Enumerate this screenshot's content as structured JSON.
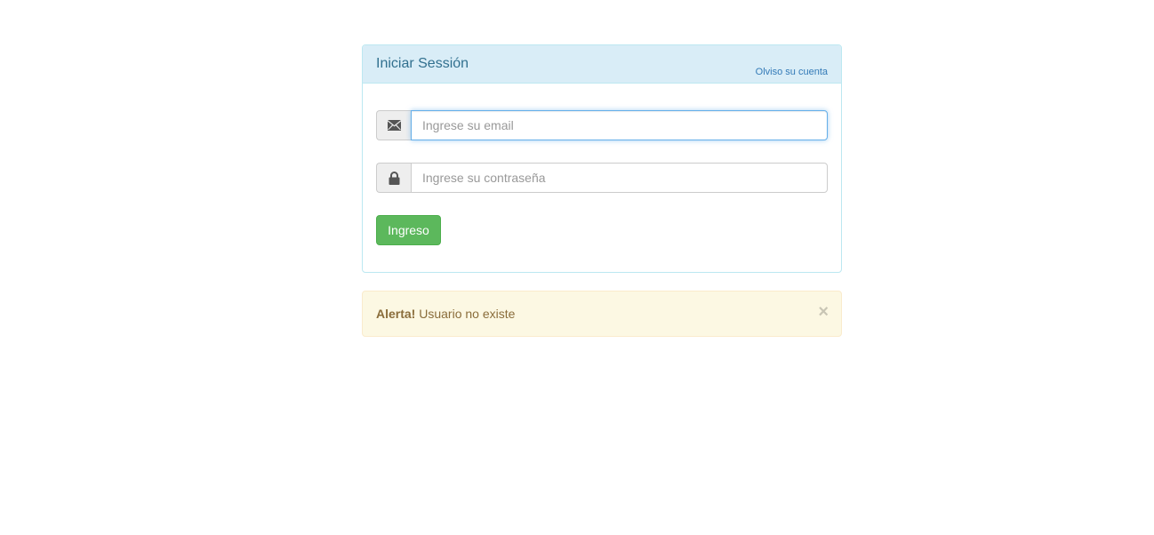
{
  "login_panel": {
    "title": "Iniciar Sessión",
    "forgot_link": "Olviso su cuenta",
    "email": {
      "icon": "envelope-icon",
      "placeholder": "Ingrese su email",
      "value": ""
    },
    "password": {
      "icon": "lock-icon",
      "placeholder": "Ingrese su contraseña",
      "value": ""
    },
    "submit_label": "Ingreso"
  },
  "alert": {
    "strong": "Alerta!",
    "message": " Usuario no existe",
    "close_symbol": "×"
  },
  "colors": {
    "panel_heading_bg": "#d9edf7",
    "panel_border": "#bce8f1",
    "panel_title": "#31708f",
    "link": "#337ab7",
    "success": "#5cb85c",
    "warning_bg": "#fcf8e3",
    "warning_text": "#8a6d3b",
    "focus_border": "#66afe9"
  }
}
